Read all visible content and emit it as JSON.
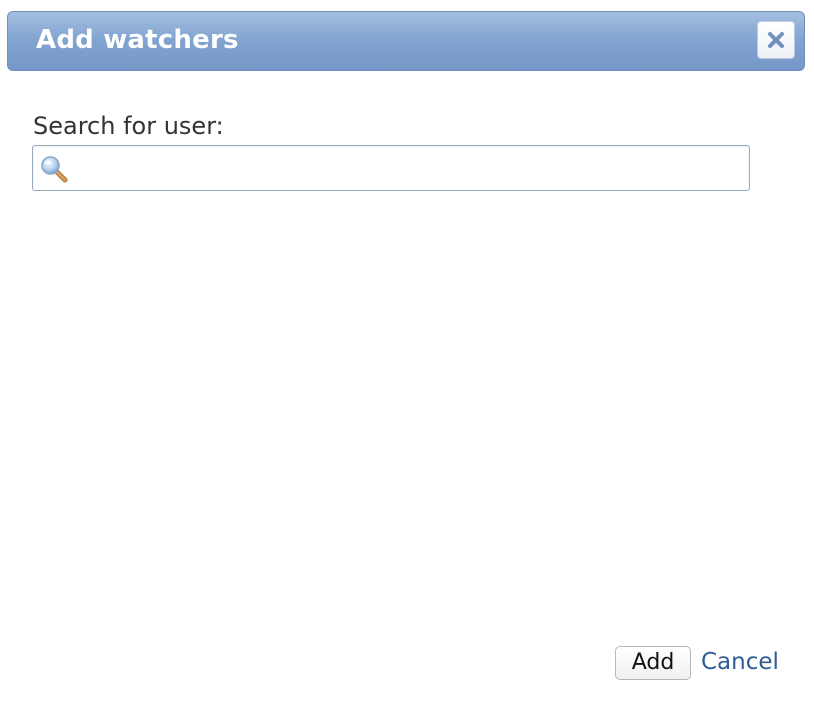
{
  "dialog": {
    "title": "Add watchers",
    "close_icon": "close-x-icon",
    "colors": {
      "titlebar": "#8aa9d4",
      "title_text": "#ffffff",
      "link": "#2f5d92"
    }
  },
  "search": {
    "label": "Search for user:",
    "value": "",
    "placeholder": "",
    "icon": "magnifier-search-icon"
  },
  "footer": {
    "add_label": "Add",
    "cancel_label": "Cancel"
  }
}
